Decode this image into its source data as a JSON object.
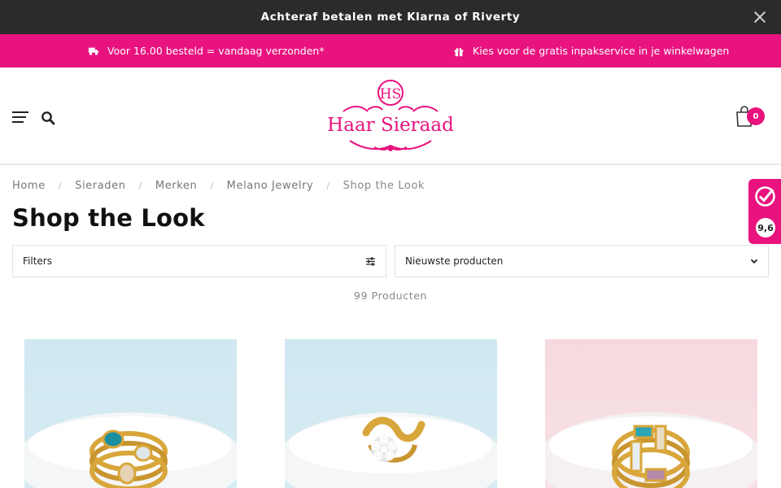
{
  "announcement": {
    "text": "Achteraf betalen met Klarna of Riverty"
  },
  "usp": [
    {
      "icon": "truck-icon",
      "text": "Voor 16.00 besteld = vandaag verzonden*"
    },
    {
      "icon": "gift-icon",
      "text": "Kies voor de gratis inpakservice in je winkelwagen"
    }
  ],
  "header": {
    "logo_monogram": "HS",
    "logo_text": "Haar Sieraad",
    "cart_count": "0"
  },
  "breadcrumb": {
    "separator": "/",
    "items": [
      "Home",
      "Sieraden",
      "Merken",
      "Melano Jewelry",
      "Shop the Look"
    ]
  },
  "page": {
    "title": "Shop the Look",
    "filters_label": "Filters",
    "sort_label": "Nieuwste producten",
    "count": "99 Producten"
  },
  "products": [
    {
      "image": "ring-teal-oval-stones",
      "background": "light-blue"
    },
    {
      "image": "ring-flower-wave",
      "background": "light-blue"
    },
    {
      "image": "ring-baguette-stones",
      "background": "light-pink"
    }
  ],
  "rating_widget": {
    "score": "9,6"
  },
  "colors": {
    "brand_pink": "#e8137e",
    "topbar": "#2b2b2b"
  }
}
